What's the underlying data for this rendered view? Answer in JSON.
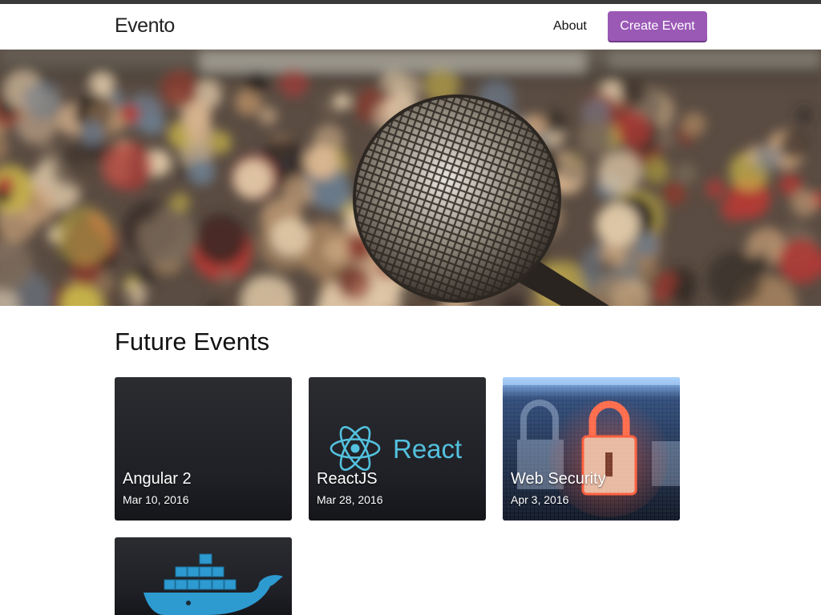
{
  "header": {
    "brand": "Evento",
    "about_label": "About",
    "create_label": "Create Event"
  },
  "section": {
    "title": "Future Events"
  },
  "events": [
    {
      "title": "Angular 2",
      "date": "Mar 10, 2016",
      "image": "dark-blank"
    },
    {
      "title": "ReactJS",
      "date": "Mar 28, 2016",
      "image": "react-logo",
      "logo_text": "React"
    },
    {
      "title": "Web Security",
      "date": "Apr 3, 2016",
      "image": "padlock-display"
    },
    {
      "title": "",
      "date": "",
      "image": "docker-whale"
    }
  ],
  "colors": {
    "accent": "#9b59b6",
    "top_strip": "#3a3a3a",
    "react_cyan": "#53c1de"
  },
  "hero": {
    "image": "microphone-in-front-of-audience"
  }
}
